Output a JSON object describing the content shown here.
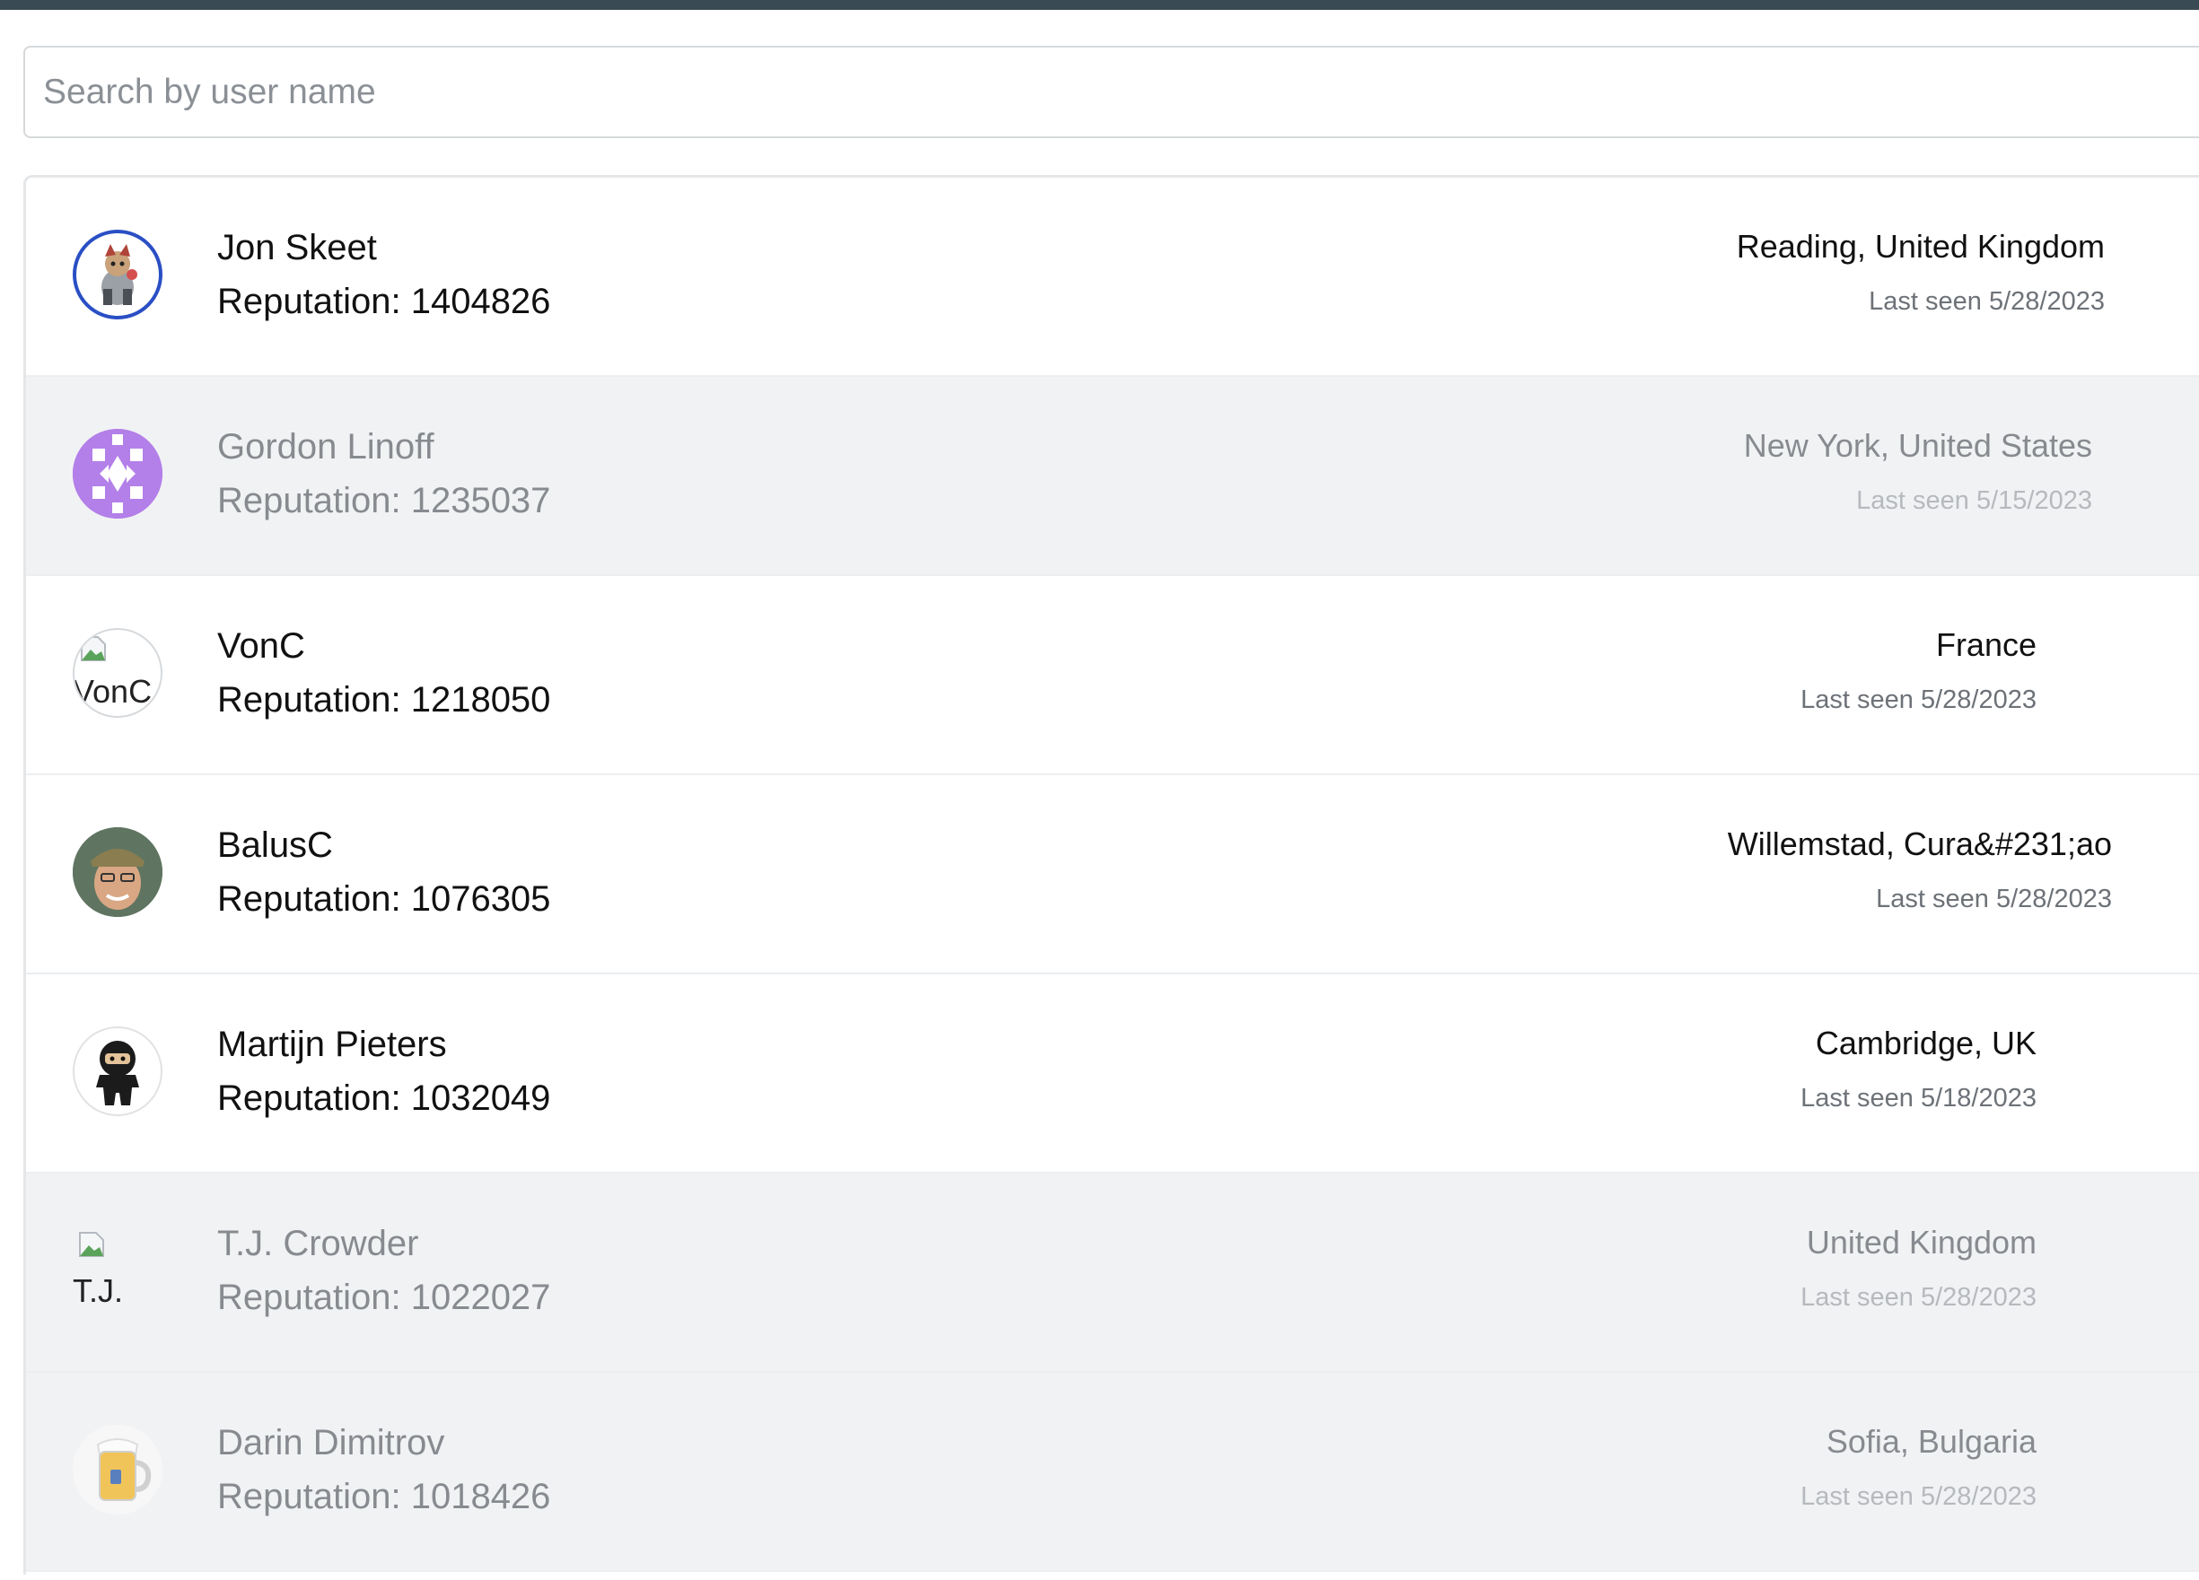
{
  "search": {
    "placeholder": "Search by user name",
    "value": ""
  },
  "users": [
    {
      "name": "Jon Skeet",
      "reputation": "Reputation: 1404826",
      "location": "Reading, United Kingdom",
      "last_seen": "Last seen 5/28/2023"
    },
    {
      "name": "Gordon Linoff",
      "reputation": "Reputation: 1235037",
      "location": "New York, United States",
      "last_seen": "Last seen 5/15/2023"
    },
    {
      "name": "VonC",
      "reputation": "Reputation: 1218050",
      "location": "France",
      "last_seen": "Last seen 5/28/2023",
      "avatar_alt": "VonC"
    },
    {
      "name": "BalusC",
      "reputation": "Reputation: 1076305",
      "location": "Willemstad, Cura&#231;ao",
      "last_seen": "Last seen 5/28/2023"
    },
    {
      "name": "Martijn Pieters",
      "reputation": "Reputation: 1032049",
      "location": "Cambridge, UK",
      "last_seen": "Last seen 5/18/2023"
    },
    {
      "name": "T.J. Crowder",
      "reputation": "Reputation: 1022027",
      "location": "United Kingdom",
      "last_seen": "Last seen 5/28/2023",
      "avatar_alt": "T.J."
    },
    {
      "name": "Darin Dimitrov",
      "reputation": "Reputation: 1018426",
      "location": "Sofia, Bulgaria",
      "last_seen": "Last seen 5/28/2023"
    }
  ],
  "colors": {
    "topbar": "#3a4a54",
    "row_dim_bg": "#f1f2f4",
    "avatar_ring_blue": "#2a4fc4",
    "avatar_purple": "#b37fe8"
  }
}
